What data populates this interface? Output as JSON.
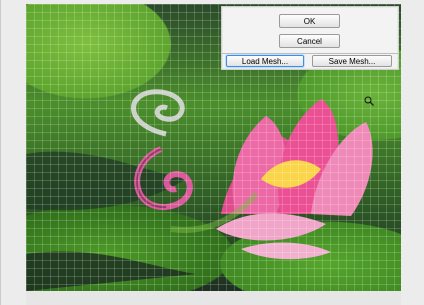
{
  "dialog": {
    "ok_label": "OK",
    "cancel_label": "Cancel",
    "load_mesh_label": "Load Mesh...",
    "save_mesh_label": "Save Mesh..."
  },
  "preview": {
    "description_icon": "liquify-preview-image",
    "tool_cursor_icon": "zoom-cursor-icon"
  },
  "colors": {
    "focus_ring": "#3d8ee8",
    "button_border": "#9a9a9a",
    "panel_bg": "#f3f3f3"
  }
}
